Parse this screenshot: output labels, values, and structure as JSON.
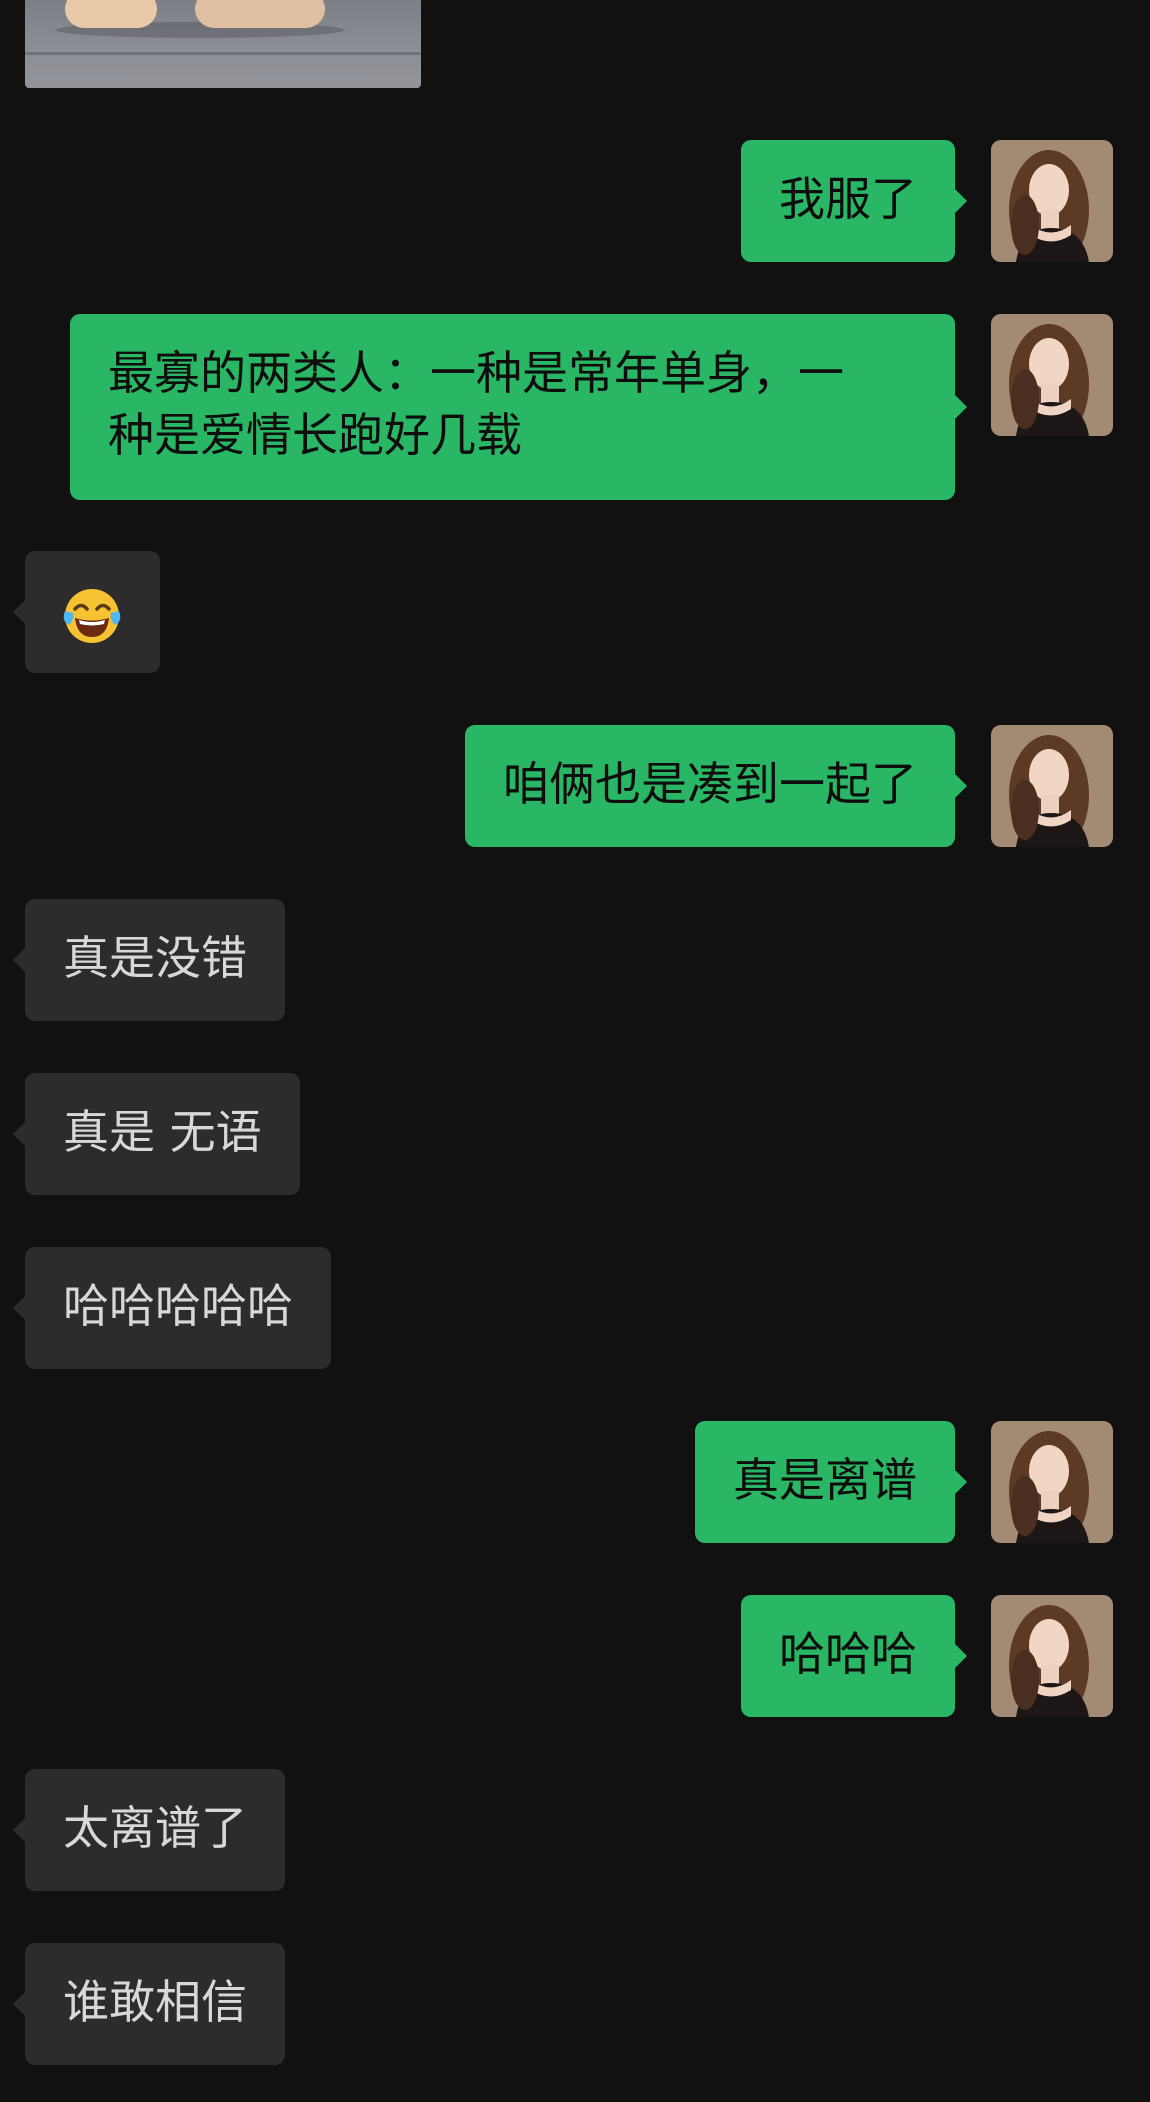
{
  "chat": {
    "messages": [
      {
        "side": "in",
        "type": "image",
        "image": "baby-on-sofa-photo"
      },
      {
        "side": "out",
        "type": "text",
        "text": "我服了"
      },
      {
        "side": "out",
        "type": "text",
        "lines": [
          "最寡的两类人：一种是常年单身，一",
          "种是爱情长跑好几载"
        ]
      },
      {
        "side": "in",
        "type": "emoji",
        "emoji": "face-with-tears-of-joy-icon"
      },
      {
        "side": "out",
        "type": "text",
        "text": "咱俩也是凑到一起了"
      },
      {
        "side": "in",
        "type": "text",
        "text": "真是没错"
      },
      {
        "side": "in",
        "type": "text",
        "text": "真是 无语"
      },
      {
        "side": "in",
        "type": "text",
        "text": "哈哈哈哈哈"
      },
      {
        "side": "out",
        "type": "text",
        "text": "真是离谱"
      },
      {
        "side": "out",
        "type": "text",
        "text": "哈哈哈"
      },
      {
        "side": "in",
        "type": "text",
        "text": "太离谱了"
      },
      {
        "side": "in",
        "type": "text",
        "text": "谁敢相信"
      }
    ]
  },
  "colors": {
    "background": "#111111",
    "incoming_bubble": "#2c2c2c",
    "outgoing_bubble": "#29b765",
    "incoming_text": "#d8d8d8",
    "outgoing_text": "#0d0d0d"
  },
  "avatar": {
    "icon": "user-avatar-woman-photo"
  }
}
